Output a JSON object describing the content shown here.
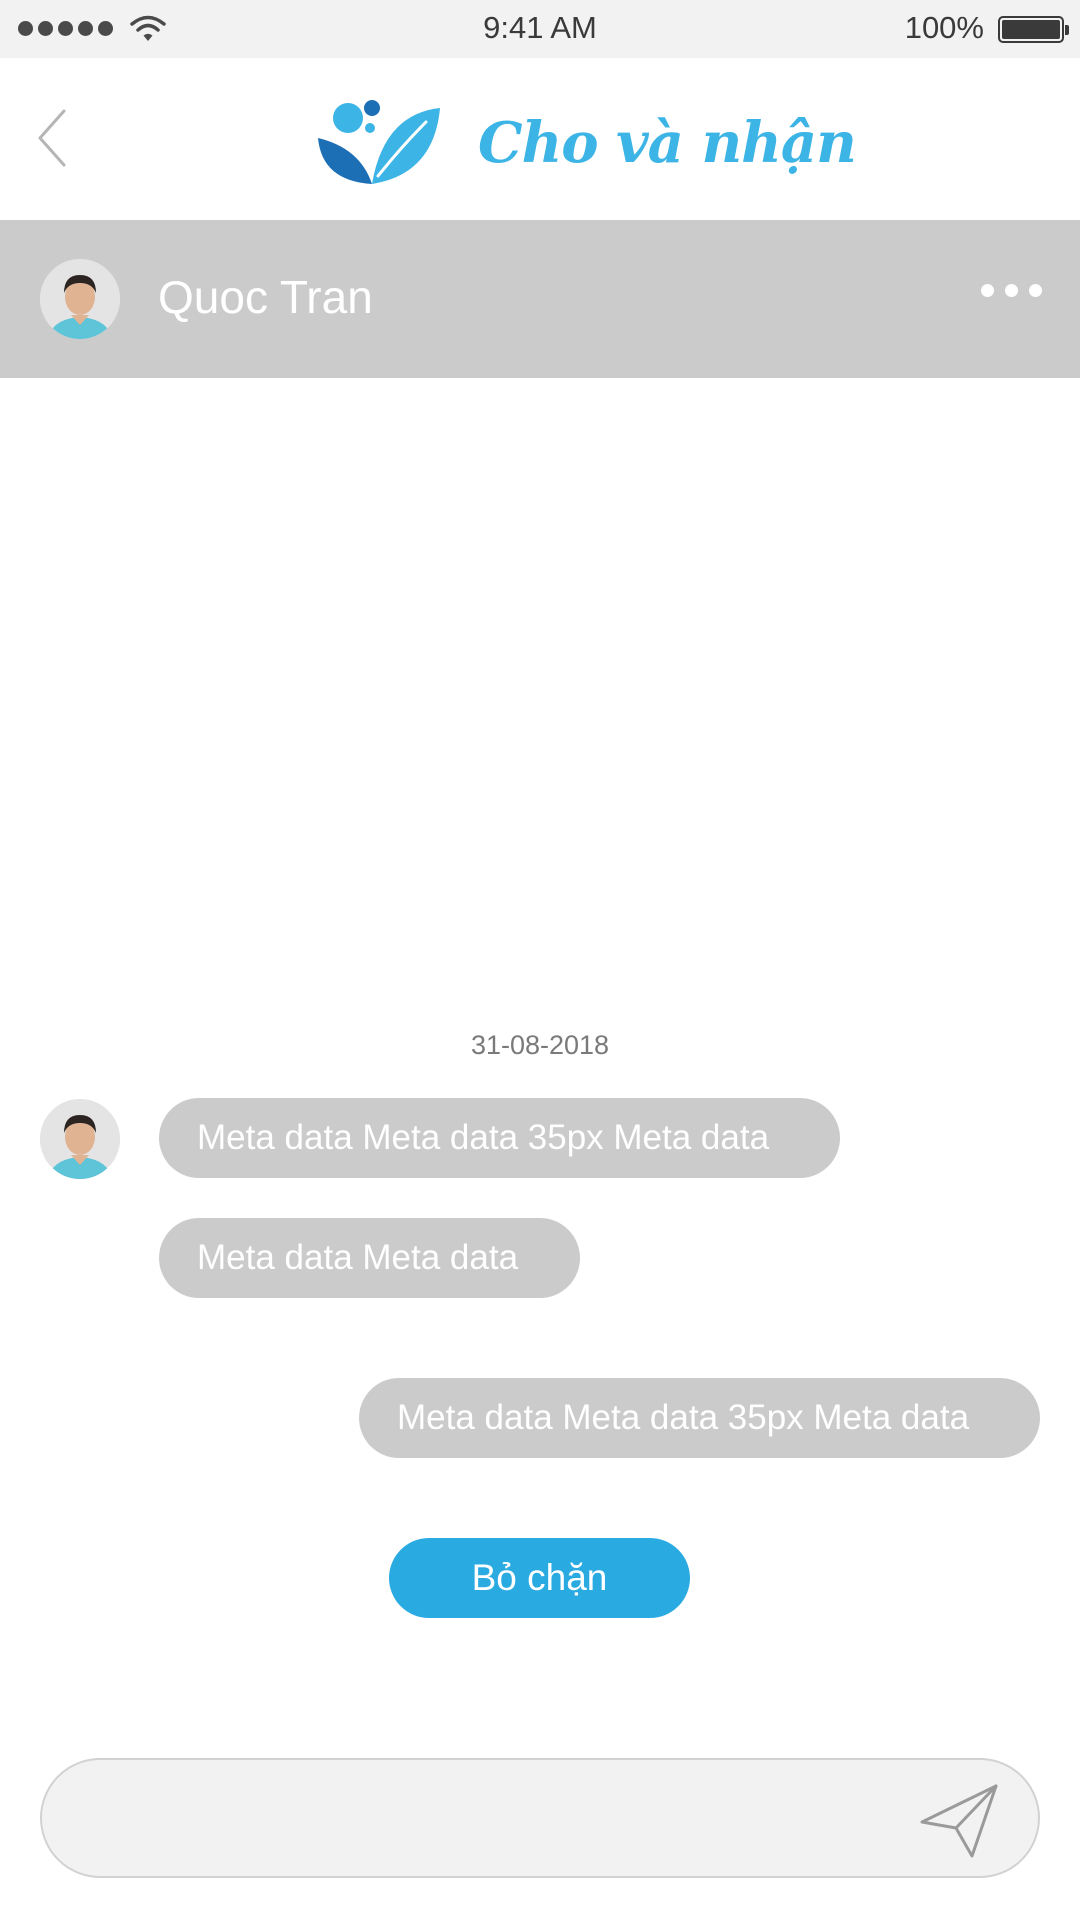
{
  "status_bar": {
    "time": "9:41 AM",
    "battery_percent": "100%",
    "signal_icon": "signal-dots-icon",
    "wifi_icon": "wifi-icon",
    "battery_icon": "battery-full-icon"
  },
  "header": {
    "back_icon": "chevron-left-icon",
    "logo_icon": "leaf-logo-icon",
    "logo_text": "Cho và nhận"
  },
  "contact": {
    "name": "Quoc Tran",
    "more_icon": "more-dots-icon"
  },
  "chat": {
    "date": "31-08-2018",
    "messages": [
      {
        "side": "left",
        "text": "Meta data Meta data 35px Meta data"
      },
      {
        "side": "left",
        "text": "Meta data Meta data"
      },
      {
        "side": "right",
        "text": "Meta data Meta data 35px Meta data"
      }
    ]
  },
  "unblock_button": {
    "label": "Bỏ chặn"
  },
  "composer": {
    "value": "",
    "placeholder": "",
    "send_icon": "send-icon"
  },
  "colors": {
    "accent": "#29abe2",
    "logo_blue": "#3cb4e5",
    "logo_dark_blue": "#1d6fb5",
    "bubble_gray": "#cbcbcb",
    "contact_bar_gray": "#cbcbcb",
    "status_bar_bg": "#f2f2f2"
  }
}
